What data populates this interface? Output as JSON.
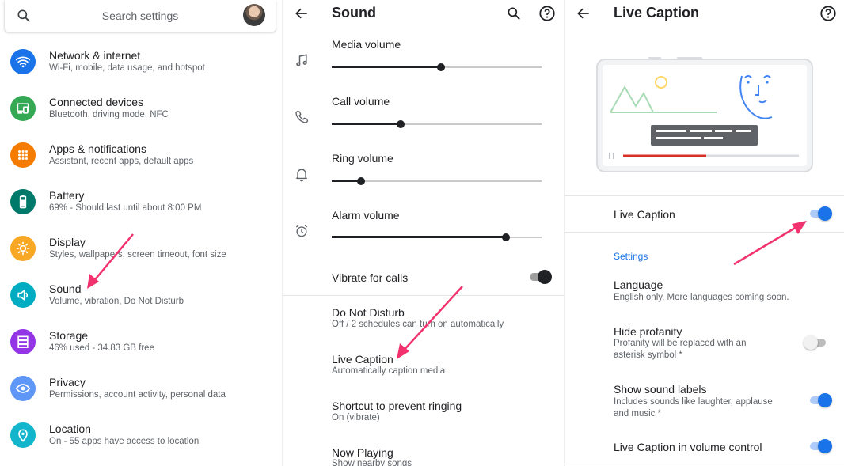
{
  "panel1": {
    "search_placeholder": "Search settings",
    "items": [
      {
        "title": "Network & internet",
        "subtitle": "Wi-Fi, mobile, data usage, and hotspot",
        "color": "#1a73e8"
      },
      {
        "title": "Connected devices",
        "subtitle": "Bluetooth, driving mode, NFC",
        "color": "#34a853"
      },
      {
        "title": "Apps & notifications",
        "subtitle": "Assistant, recent apps, default apps",
        "color": "#f57c00"
      },
      {
        "title": "Battery",
        "subtitle": "69% - Should last until about 8:00 PM",
        "color": "#00796b"
      },
      {
        "title": "Display",
        "subtitle": "Styles, wallpapers, screen timeout, font size",
        "color": "#f9a825"
      },
      {
        "title": "Sound",
        "subtitle": "Volume, vibration, Do Not Disturb",
        "color": "#00acc1"
      },
      {
        "title": "Storage",
        "subtitle": "46% used - 34.83 GB free",
        "color": "#9334e6"
      },
      {
        "title": "Privacy",
        "subtitle": "Permissions, account activity, personal data",
        "color": "#5e97f6"
      },
      {
        "title": "Location",
        "subtitle": "On - 55 apps have access to location",
        "color": "#12b5cb"
      }
    ]
  },
  "panel2": {
    "title": "Sound",
    "volumes": [
      {
        "label": "Media volume",
        "level": 0.52
      },
      {
        "label": "Call volume",
        "level": 0.33
      },
      {
        "label": "Ring volume",
        "level": 0.14
      },
      {
        "label": "Alarm volume",
        "level": 0.83
      }
    ],
    "vibrate_label": "Vibrate for calls",
    "vibrate_on": true,
    "rows": [
      {
        "title": "Do Not Disturb",
        "subtitle": "Off / 2 schedules can turn on automatically"
      },
      {
        "title": "Live Caption",
        "subtitle": "Automatically caption media"
      },
      {
        "title": "Shortcut to prevent ringing",
        "subtitle": "On (vibrate)"
      },
      {
        "title": "Now Playing",
        "subtitle": "Show nearby songs"
      }
    ]
  },
  "panel3": {
    "title": "Live Caption",
    "main_toggle_label": "Live Caption",
    "main_toggle_on": true,
    "section_header": "Settings",
    "language_title": "Language",
    "language_sub": "English only. More languages coming soon.",
    "profanity_title": "Hide profanity",
    "profanity_sub_1": "Profanity will be replaced with an",
    "profanity_sub_2": "asterisk symbol *",
    "profanity_on": false,
    "sound_labels_title": "Show sound labels",
    "sound_labels_sub_1": "Includes sounds like laughter, applause",
    "sound_labels_sub_2": "and music *",
    "sound_labels_on": true,
    "volume_control_title": "Live Caption in volume control",
    "volume_control_on": true
  },
  "colors": {
    "accent": "#1a73e8",
    "annotation_arrow": "#f2326e"
  }
}
